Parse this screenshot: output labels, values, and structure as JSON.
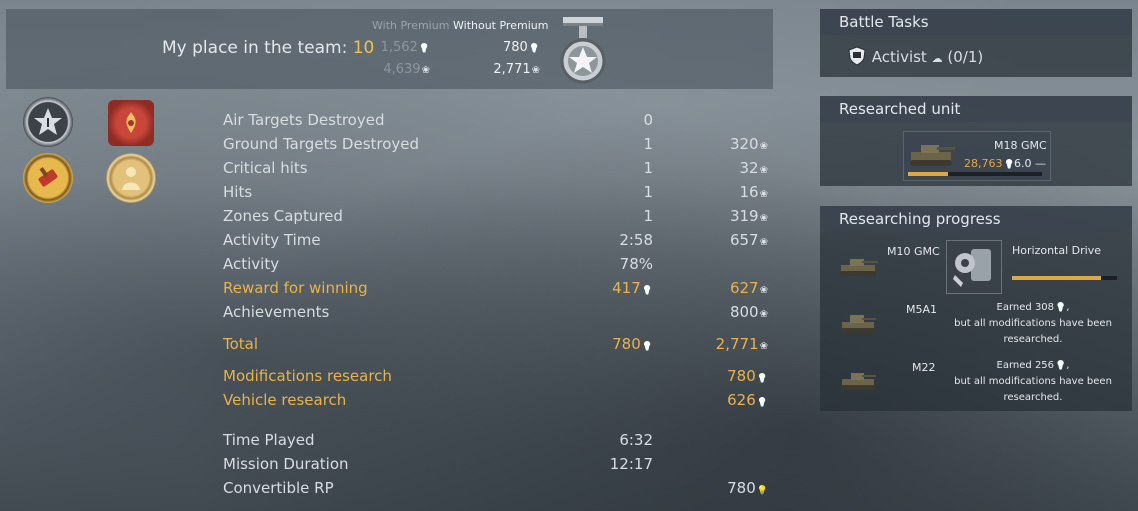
{
  "team": {
    "place_label": "My place in the team:",
    "place_value": "10",
    "with_premium_label": "With Premium",
    "without_premium_label": "Without Premium",
    "with_rp": "1,562",
    "with_sl": "4,639",
    "without_rp": "780",
    "without_sl": "2,771"
  },
  "badges": [
    "rank-star-icon",
    "ornament-icon",
    "brush-icon",
    "soldier-icon"
  ],
  "stats": [
    {
      "label": "Air Targets Destroyed",
      "v1": "0",
      "v2": "",
      "unit": ""
    },
    {
      "label": "Ground Targets Destroyed",
      "v1": "1",
      "v2": "320",
      "unit": "sl"
    },
    {
      "label": "Critical hits",
      "v1": "1",
      "v2": "32",
      "unit": "sl"
    },
    {
      "label": "Hits",
      "v1": "1",
      "v2": "16",
      "unit": "sl"
    },
    {
      "label": "Zones Captured",
      "v1": "1",
      "v2": "319",
      "unit": "sl"
    },
    {
      "label": "Activity Time",
      "v1": "2:58",
      "v2": "657",
      "unit": "sl"
    },
    {
      "label": "Activity",
      "v1": "78%",
      "v2": "",
      "unit": ""
    },
    {
      "label": "Reward for winning",
      "v1": "417",
      "v2": "627",
      "unit": "sl"
    },
    {
      "label": "Achievements",
      "v1": "",
      "v2": "800",
      "unit": "sl"
    },
    {
      "label": "Total",
      "v1": "780",
      "v2": "2,771",
      "unit": "sl"
    },
    {
      "label": "Modifications research",
      "v1": "",
      "v2": "780",
      "unit": "rp"
    },
    {
      "label": "Vehicle research",
      "v1": "",
      "v2": "626",
      "unit": "rp"
    },
    {
      "label": "Time Played",
      "v1": "6:32",
      "v2": "",
      "unit": ""
    },
    {
      "label": "Mission Duration",
      "v1": "12:17",
      "v2": "",
      "unit": ""
    },
    {
      "label": "Convertible RP",
      "v1": "",
      "v2": "780",
      "unit": "crp"
    }
  ],
  "battle_tasks": {
    "title": "Battle Tasks",
    "task_name": "Activist",
    "task_progress": "(0/1)"
  },
  "researched_unit": {
    "title": "Researched unit",
    "name": "M18 GMC",
    "rp": "28,763",
    "br": "6.0",
    "progress_fraction": 0.3
  },
  "research_progress": {
    "title": "Researching progress",
    "items": [
      {
        "vehicle": "M10 GMC",
        "mod_name": "Horizontal Drive",
        "mod_progress_fraction": 0.85
      },
      {
        "vehicle": "M5A1",
        "line1": "Earned 308",
        "line2": "but all modifications have been",
        "line3": "researched."
      },
      {
        "vehicle": "M22",
        "line1": "Earned 256",
        "line2": "but all modifications have been",
        "line3": "researched."
      }
    ]
  },
  "colors": {
    "accent_gold": "#e8b34a",
    "panel": "#2c343c"
  }
}
